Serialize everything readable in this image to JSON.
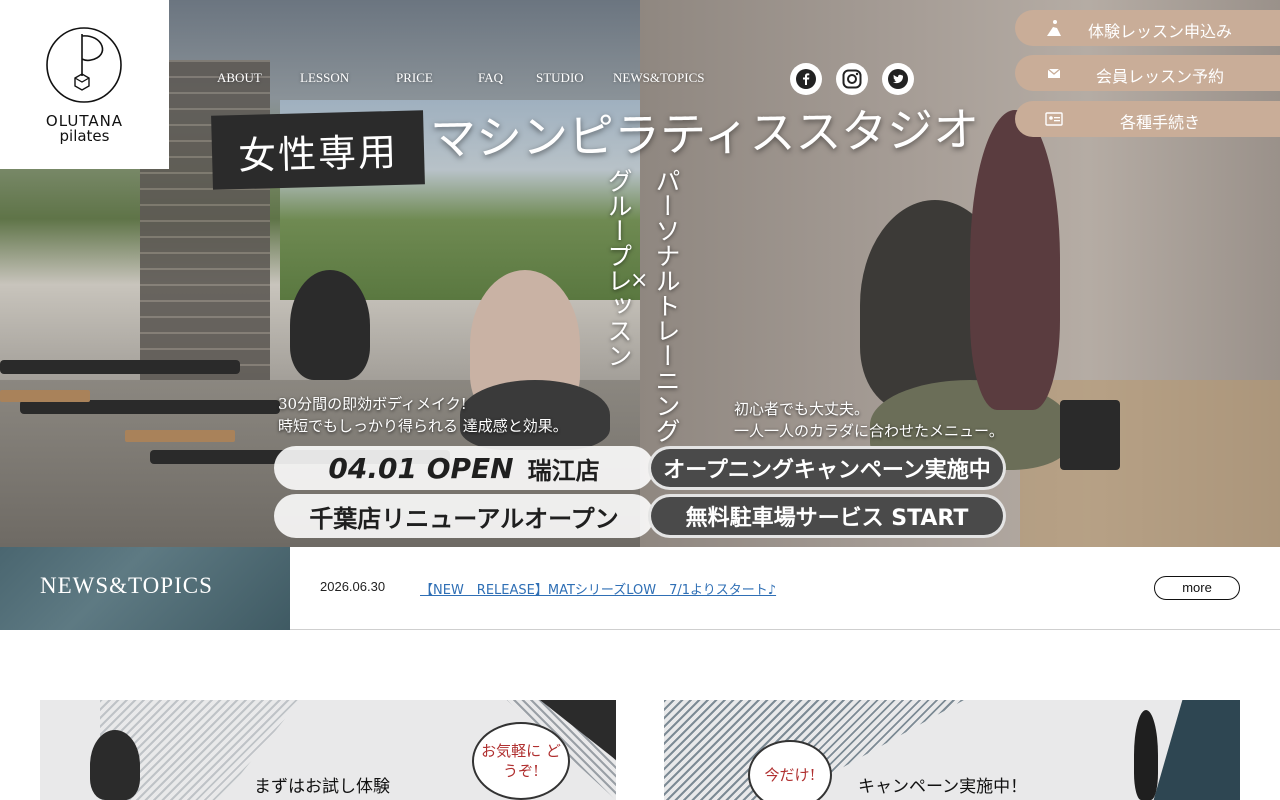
{
  "logo": {
    "line1": "OLUTANA",
    "line2": "pilates"
  },
  "nav": {
    "items": [
      {
        "label": "ABOUT"
      },
      {
        "label": "LESSON"
      },
      {
        "label": "PRICE"
      },
      {
        "label": "FAQ"
      },
      {
        "label": "STUDIO"
      },
      {
        "label": "NEWS&TOPICS"
      }
    ]
  },
  "social": {
    "icons": [
      "facebook-icon",
      "instagram-icon",
      "twitter-icon"
    ]
  },
  "cta": {
    "trial": "体験レッスン申込み",
    "reserve": "会員レッスン予約",
    "procedures": "各種手続き",
    "color": "#c9ad98"
  },
  "hero": {
    "tag": "女性専用",
    "headline": "マシンピラティススタジオ",
    "vertical_group": "グループレッスン",
    "vertical_personal": "パーソナルトレーニング",
    "cross": "×",
    "caption_left_1": "30分間の即効ボディメイク!",
    "caption_left_2": "時短でもしっかり得られる 達成感と効果。",
    "caption_right_1": "初心者でも大丈夫。",
    "caption_right_2": "一人一人のカラダに合わせたメニュー。",
    "open_date": "04.01 OPEN",
    "open_store": "瑞江店",
    "campaign": "オープニングキャンペーン実施中",
    "chiba": "千葉店リニューアルオープン",
    "parking": "無料駐車場サービス START"
  },
  "news": {
    "label": "NEWS&TOPICS",
    "date": "2026.06.30",
    "headline": "【NEW　RELEASE】MATシリーズLOW　7/1よりスタート♪",
    "more": "more"
  },
  "cards": {
    "trial_title": "まずはお試し体験",
    "trial_bubble": "お気軽に どうぞ!",
    "campaign_title": "キャンペーン実施中！",
    "campaign_bubble": "今だけ!"
  }
}
